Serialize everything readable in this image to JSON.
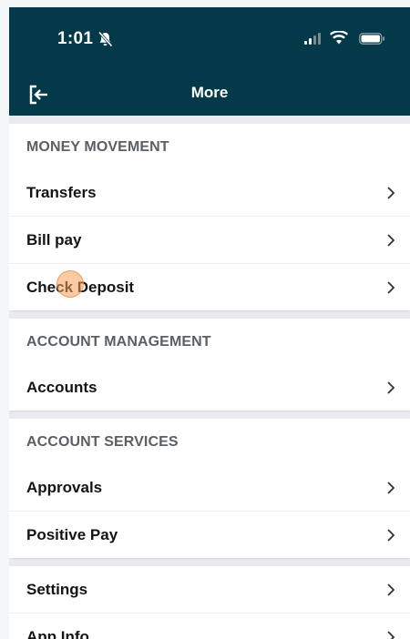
{
  "status_bar": {
    "time": "1:01"
  },
  "header": {
    "title": "More"
  },
  "sections": [
    {
      "title": "MONEY MOVEMENT",
      "items": [
        "Transfers",
        "Bill pay",
        "Check Deposit"
      ]
    },
    {
      "title": "ACCOUNT MANAGEMENT",
      "items": [
        "Accounts"
      ]
    },
    {
      "title": "ACCOUNT SERVICES",
      "items": [
        "Approvals",
        "Positive Pay"
      ]
    },
    {
      "title": "",
      "items": [
        "Settings",
        "App Info"
      ]
    }
  ],
  "colors": {
    "header_bg": "#04394a",
    "background": "#e9ebee"
  }
}
